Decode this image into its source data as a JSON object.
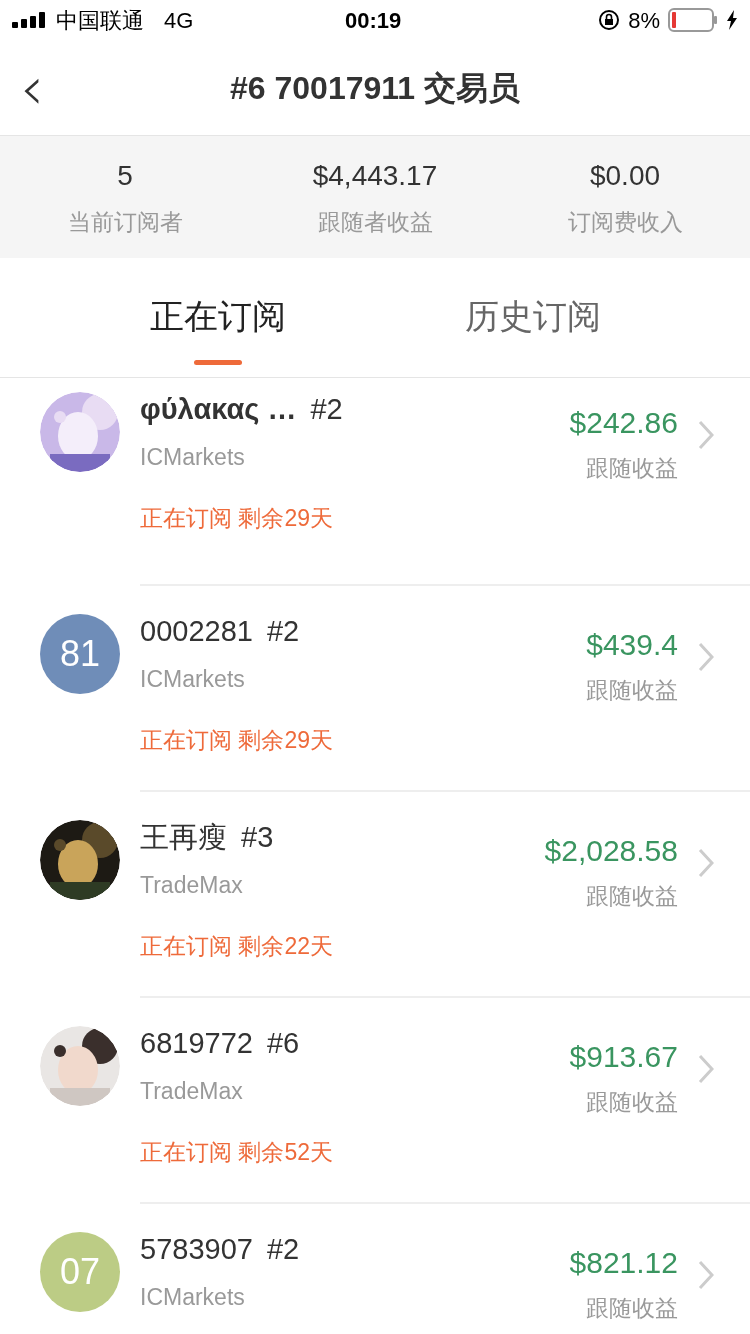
{
  "status_bar": {
    "carrier": "中国联通",
    "network": "4G",
    "time": "00:19",
    "battery": "8%"
  },
  "nav": {
    "back": "‹",
    "title": "#6 70017911 交易员"
  },
  "stats": [
    {
      "value": "5",
      "label": "当前订阅者"
    },
    {
      "value": "$4,443.17",
      "label": "跟随者收益"
    },
    {
      "value": "$0.00",
      "label": "订阅费收入"
    }
  ],
  "tabs": [
    {
      "label": "正在订阅",
      "selected": true
    },
    {
      "label": "历史订阅",
      "selected": false
    }
  ],
  "subscribers": [
    {
      "name": "φύλακας …",
      "account": "#2",
      "broker": "ICMarkets",
      "profit": "$242.86",
      "profit_label": "跟随收益",
      "status": "正在订阅 剩余29天"
    },
    {
      "avatar": {
        "kind": "initials",
        "text": "81",
        "color": "#6f8db8"
      },
      "name": "0002281",
      "account": "#2",
      "broker": "ICMarkets",
      "profit": "$439.4",
      "profit_label": "跟随收益",
      "status": "正在订阅 剩余29天"
    },
    {
      "name": "王再瘦",
      "account": "#3",
      "broker": "TradeMax",
      "profit": "$2,028.58",
      "profit_label": "跟随收益",
      "status": "正在订阅 剩余22天"
    },
    {
      "name": "6819772",
      "account": "#6",
      "broker": "TradeMax",
      "profit": "$913.67",
      "profit_label": "跟随收益",
      "status": "正在订阅 剩余52天"
    },
    {
      "avatar": {
        "kind": "initials",
        "text": "07",
        "color": "#bccc85"
      },
      "name": "5783907",
      "account": "#2",
      "broker": "ICMarkets",
      "profit": "$821.12",
      "profit_label": "跟随收益"
    }
  ]
}
